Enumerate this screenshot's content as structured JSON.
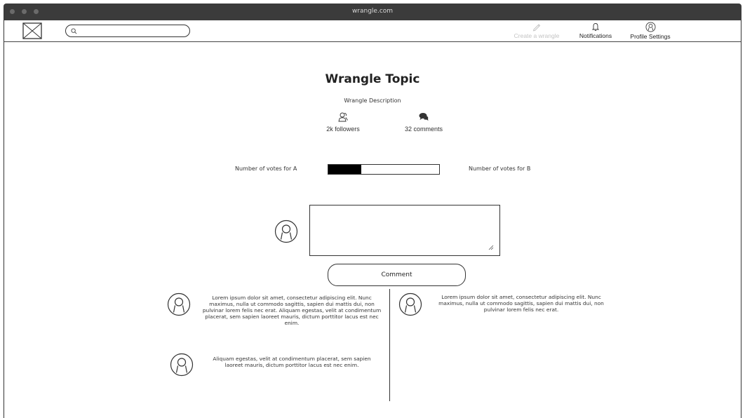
{
  "window": {
    "title": "wrangle.com"
  },
  "navbar": {
    "search_placeholder": "",
    "create_label": "Create a wrangle",
    "notifications_label": "Notifications",
    "profile_label": "Profile Settings"
  },
  "topic": {
    "title": "Wrangle Topic",
    "description": "Wrangle Description",
    "followers": "2k followers",
    "comments": "32 comments"
  },
  "votes": {
    "label_a": "Number of votes for A",
    "label_b": "Number of votes for B",
    "share_a": 0.3
  },
  "composer": {
    "button_label": "Comment"
  },
  "comments": [
    {
      "text": "Lorem ipsum dolor sit amet, consectetur adipiscing elit. Nunc maximus, nulla ut commodo sagittis, sapien dui mattis dui, non pulvinar lorem felis nec erat. Aliquam egestas, velit at condimentum placerat, sem sapien laoreet mauris, dictum porttitor lacus est nec enim."
    },
    {
      "text": "Lorem ipsum dolor sit amet, consectetur adipiscing elit. Nunc maximus, nulla ut commodo sagittis, sapien dui mattis dui, non pulvinar lorem felis nec erat."
    },
    {
      "text": "Aliquam egestas, velit at condimentum placerat, sem sapien laoreet mauris, dictum porttitor lacus est nec enim."
    }
  ],
  "colors": {
    "chrome": "#3b3b3b",
    "ink": "#222222",
    "disabled": "#c4c4c4",
    "vote_fill": "#000000"
  },
  "icons": {
    "logo": "image-placeholder-icon",
    "search": "search-icon",
    "create": "pencil-icon",
    "notifications": "bell-icon",
    "profile": "user-circle-icon",
    "followers": "users-icon",
    "comments": "chat-bubbles-icon",
    "avatar": "user-circle-icon"
  }
}
